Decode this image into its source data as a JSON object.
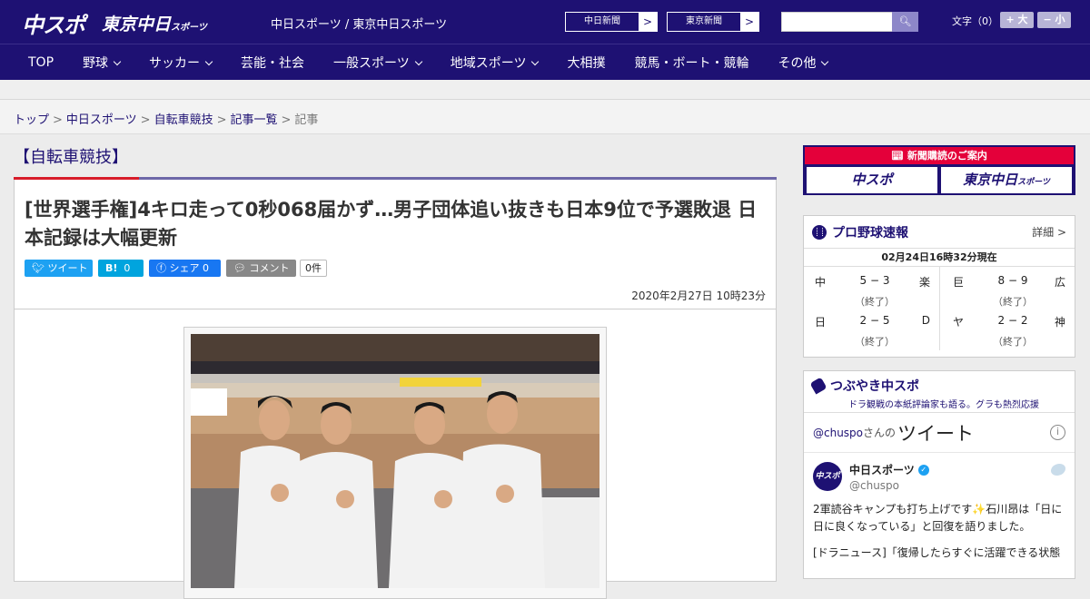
{
  "header": {
    "logo_main": "中スポ",
    "logo_sub": "東京中日",
    "logo_sub_small": "スポーツ",
    "site_title": "中日スポーツ / 東京中日スポーツ",
    "paper_links": [
      {
        "label": "中日新聞",
        "arrow": ">"
      },
      {
        "label": "東京新聞",
        "arrow": ">"
      }
    ],
    "search_placeholder": "",
    "fontsize_label": "文字（0）",
    "fontsize_up": "+ 大",
    "fontsize_down": "− 小"
  },
  "nav": [
    {
      "label": "TOP",
      "dropdown": false
    },
    {
      "label": "野球",
      "dropdown": true
    },
    {
      "label": "サッカー",
      "dropdown": true
    },
    {
      "label": "芸能・社会",
      "dropdown": false
    },
    {
      "label": "一般スポーツ",
      "dropdown": true
    },
    {
      "label": "地域スポーツ",
      "dropdown": true
    },
    {
      "label": "大相撲",
      "dropdown": false
    },
    {
      "label": "競馬・ボート・競輪",
      "dropdown": false
    },
    {
      "label": "その他",
      "dropdown": true
    }
  ],
  "breadcrumb": {
    "items": [
      "トップ",
      "中日スポーツ",
      "自転車競技",
      "記事一覧"
    ],
    "current": "記事",
    "separator": ">"
  },
  "article": {
    "category": "【自転車競技】",
    "headline": "[世界選手権]4キロ走って0秒068届かず…男子団体追い抜きも日本9位で予選敗退 日本記録は大幅更新",
    "share": {
      "tweet": "ツイート",
      "hatena": "B!",
      "hatena_count": "0",
      "facebook": "シェア",
      "facebook_count": "0",
      "comment": "コメント",
      "comment_count": "0件"
    },
    "date": "2020年2月27日 10時23分"
  },
  "sidebar": {
    "subscribe_label": "新聞購読のご案内",
    "subscribe_logo_1": "中スポ",
    "subscribe_logo_2": "東京中日",
    "subscribe_logo_2_small": "スポーツ",
    "baseball": {
      "title": "プロ野球速報",
      "more": "詳細 >",
      "time": "02月24日16時32分現在",
      "games": [
        {
          "home": "中",
          "score": "5 − 3",
          "away": "楽",
          "status": "（終了）"
        },
        {
          "home": "日",
          "score": "2 − 5",
          "away": "D",
          "status": "（終了）"
        },
        {
          "home": "巨",
          "score": "8 − 9",
          "away": "広",
          "status": "（終了）"
        },
        {
          "home": "ヤ",
          "score": "2 − 2",
          "away": "神",
          "status": "（終了）"
        }
      ]
    },
    "twitter": {
      "title": "つぶやき中スポ",
      "subtitle": "ドラ観戦の本紙評論家も語る。グラも熱烈応援",
      "handle": "@chuspo",
      "handle_suffix": "さんの",
      "tweets_label": "ツイート",
      "account_name": "中日スポーツ",
      "account_at": "@chuspo",
      "tweet_line1": "2軍読谷キャンプも打ち上げです✨石川昂は「日に日に良くなっている」と回復を語りました。",
      "tweet_line2": "[ドラニュース]「復帰したらすぐに活躍できる状態"
    }
  }
}
